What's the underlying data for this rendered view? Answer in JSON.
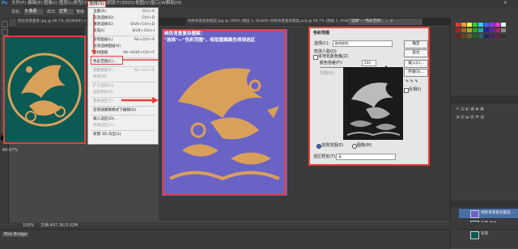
{
  "app": {
    "logo": "Ps"
  },
  "menubar": {
    "items": [
      "文件(F)",
      "编辑(E)",
      "图像(I)",
      "图层(L)",
      "类型(Y)",
      "选择(S)",
      "滤镜(T)",
      "3D(D)",
      "视图(V)",
      "窗口(W)",
      "帮助(H)"
    ]
  },
  "options": {
    "feather_label": "羽化:",
    "feather_value": "0 像素",
    "style_label": "样式:",
    "style_value": "正常",
    "width_label": "宽度:"
  },
  "tabs": [
    "羽化背景复杂 jpg @ 66.7% (RGB/8#) ×",
    "纯色背景复杂图案 jpg @ 100% (图层 1, RGB/8#) ×",
    "纯色背景复杂图案.psd @ 66.7% (图层 1, RGB/8#) ×",
    "\"选择\"—\"色彩范围\"，... ×"
  ],
  "select_menu": {
    "items": [
      {
        "label": "全部(A)",
        "shortcut": "Ctrl+A",
        "enabled": true
      },
      {
        "label": "取消选择(D)",
        "shortcut": "Ctrl+D",
        "enabled": true
      },
      {
        "label": "重新选择(E)",
        "shortcut": "Shift+Ctrl+D",
        "enabled": true
      },
      {
        "label": "反向(I)",
        "shortcut": "Shift+Ctrl+I",
        "enabled": true
      },
      {
        "label": "所有图层(L)",
        "shortcut": "Alt+Ctrl+A",
        "enabled": true
      },
      {
        "label": "取消选择图层(S)",
        "shortcut": "",
        "enabled": true
      },
      {
        "label": "查找图层",
        "shortcut": "Alt+Shift+Ctrl+F",
        "enabled": true
      },
      {
        "label": "色彩范围(C)...",
        "shortcut": "",
        "enabled": true
      },
      {
        "label": "调整蒙版(F)...",
        "shortcut": "Alt+Ctrl+R",
        "enabled": false
      },
      {
        "label": "修改(M)",
        "shortcut": "",
        "enabled": false
      },
      {
        "label": "扩大选取(G)",
        "shortcut": "",
        "enabled": false
      },
      {
        "label": "选取相似(R)",
        "shortcut": "",
        "enabled": false
      },
      {
        "label": "变换选区(T)",
        "shortcut": "",
        "enabled": false
      },
      {
        "label": "在快速蒙版模式下编辑(Q)",
        "shortcut": "",
        "enabled": true
      },
      {
        "label": "载入选区(O)...",
        "shortcut": "",
        "enabled": true
      },
      {
        "label": "存储选区(V)...",
        "shortcut": "",
        "enabled": false
      },
      {
        "label": "新建 3D 凸出(3)",
        "shortcut": "",
        "enabled": true
      }
    ]
  },
  "annotation": {
    "line1": "纯色背景复杂图案：",
    "line2": "\"选择\"—\"色彩范围\"，吸取图案颜色得到选区"
  },
  "dialog": {
    "title": "色彩范围",
    "select_label": "选择(C):",
    "select_value": "取样颜色",
    "localized_label": "检测人脸(D)",
    "localized_clusters": "本地化颜色簇(Z)",
    "fuzziness_label": "颜色容差(F):",
    "fuzziness_value": "200",
    "range_label": "范围(R):",
    "radio_selection": "选择范围(E)",
    "radio_image": "图像(M)",
    "preview_label": "选区预览(T):",
    "preview_value": "无",
    "ok": "确定",
    "cancel": "复位",
    "load": "载入(L)...",
    "save": "存储(S)...",
    "invert": "反相(I)"
  },
  "left_doc": {
    "zoom": "66.67%"
  },
  "status": {
    "zoom": "100%",
    "doc": "文档:497.2K/3.02M"
  },
  "minibridge": {
    "label": "Mini Bridge"
  },
  "layers": {
    "items": [
      {
        "name": "纯色背景复杂图案...",
        "selected": true
      },
      {
        "name": "背景 副本",
        "selected": false
      },
      {
        "name": "背景",
        "selected": false
      }
    ]
  },
  "colors": {
    "accent": "#e8403a",
    "teal": "#0b5a54",
    "gold": "#d9a05a",
    "purple": "#6a63c6"
  }
}
